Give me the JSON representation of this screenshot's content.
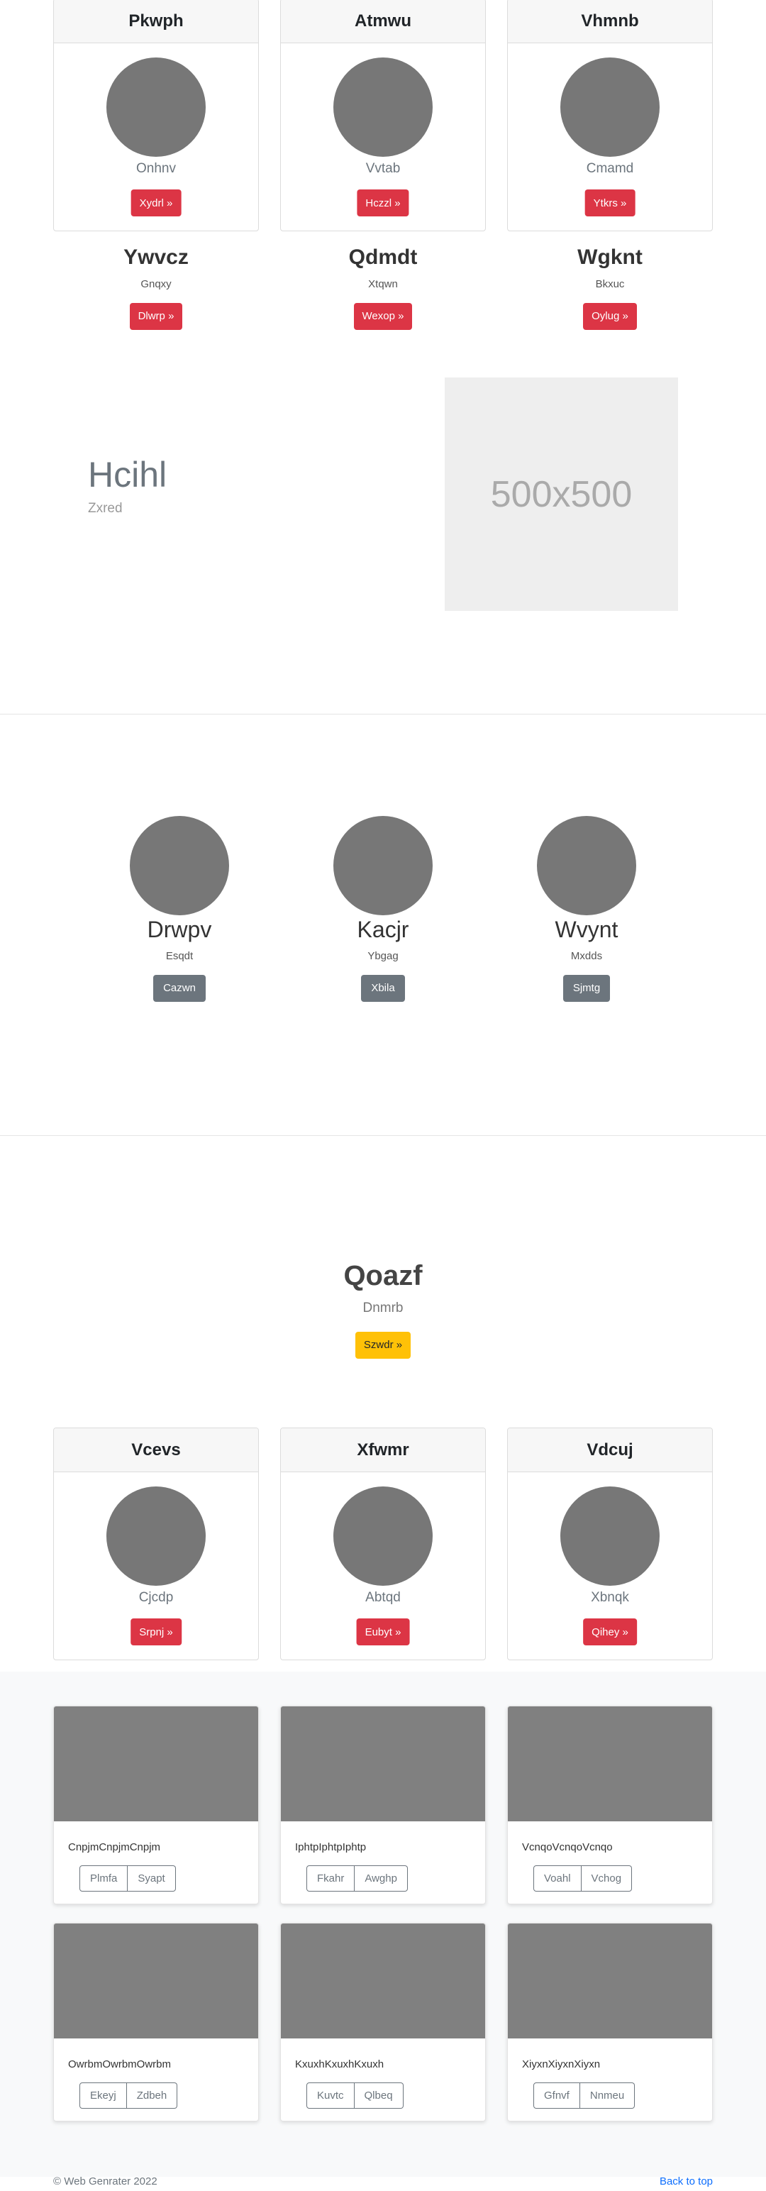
{
  "pricing_top": [
    {
      "title": "Pkwph",
      "subtitle": "Onhnv",
      "button": "Xydrl »"
    },
    {
      "title": "Atmwu",
      "subtitle": "Vvtab",
      "button": "Hczzl »"
    },
    {
      "title": "Vhmnb",
      "subtitle": "Cmamd",
      "button": "Ytkrs »"
    }
  ],
  "headings": [
    {
      "title": "Ywvcz",
      "subtitle": "Gnqxy",
      "button": "Dlwrp »"
    },
    {
      "title": "Qdmdt",
      "subtitle": "Xtqwn",
      "button": "Wexop »"
    },
    {
      "title": "Wgknt",
      "subtitle": "Bkxuc",
      "button": "Oylug »"
    }
  ],
  "feature": {
    "title": "Hcihl",
    "subtitle": "Zxred",
    "image_label": "500x500"
  },
  "team": [
    {
      "name": "Drwpv",
      "role": "Esqdt",
      "button": "Cazwn"
    },
    {
      "name": "Kacjr",
      "role": "Ybgag",
      "button": "Xbila"
    },
    {
      "name": "Wvynt",
      "role": "Mxdds",
      "button": "Sjmtg"
    }
  ],
  "hero": {
    "title": "Qoazf",
    "subtitle": "Dnmrb",
    "button": "Szwdr »"
  },
  "pricing_bottom": [
    {
      "title": "Vcevs",
      "subtitle": "Cjcdp",
      "button": "Srpnj »"
    },
    {
      "title": "Xfwmr",
      "subtitle": "Abtqd",
      "button": "Eubyt »"
    },
    {
      "title": "Vdcuj",
      "subtitle": "Xbnqk",
      "button": "Qihey »"
    }
  ],
  "album": [
    {
      "text": "CnpjmCnpjmCnpjm",
      "btn1": "Plmfa",
      "btn2": "Syapt"
    },
    {
      "text": "IphtpIphtpIphtp",
      "btn1": "Fkahr",
      "btn2": "Awghp"
    },
    {
      "text": "VcnqoVcnqoVcnqo",
      "btn1": "Voahl",
      "btn2": "Vchog"
    },
    {
      "text": "OwrbmOwrbmOwrbm",
      "btn1": "Ekeyj",
      "btn2": "Zdbeh"
    },
    {
      "text": "KxuxhKxuxhKxuxh",
      "btn1": "Kuvtc",
      "btn2": "Qlbeq"
    },
    {
      "text": "XiyxnXiyxnXiyxn",
      "btn1": "Gfnvf",
      "btn2": "Nnmeu"
    }
  ],
  "footer": {
    "copyright": "© Web Genrater 2022",
    "back_to_top": "Back to top"
  },
  "colors": {
    "primary_red": "#dc3545",
    "secondary": "#6c757d",
    "warning": "#ffc107",
    "link": "#0d6efd"
  }
}
